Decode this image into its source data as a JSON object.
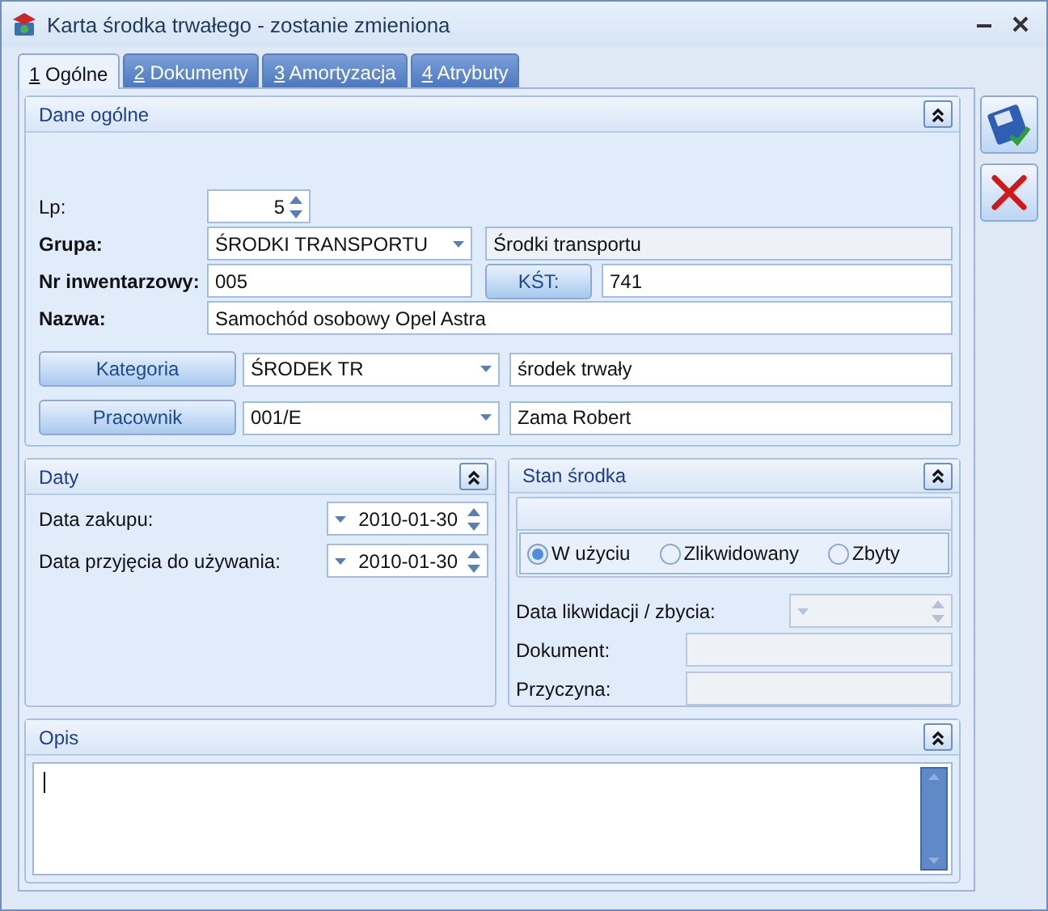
{
  "window": {
    "title": "Karta środka trwałego - zostanie zmieniona"
  },
  "tabs": [
    {
      "key": "1",
      "label": "Ogólne",
      "selected": true
    },
    {
      "key": "2",
      "label": "Dokumenty",
      "selected": false
    },
    {
      "key": "3",
      "label": "Amortyzacja",
      "selected": false
    },
    {
      "key": "4",
      "label": "Atrybuty",
      "selected": false
    }
  ],
  "general": {
    "title": "Dane ogólne",
    "expanded": true,
    "lp": {
      "label": "Lp:",
      "required": false,
      "value": "5"
    },
    "grupa": {
      "label": "Grupa:",
      "required": true,
      "value": "ŚRODKI TRANSPORTU",
      "description": "Środki transportu"
    },
    "nr": {
      "label": "Nr inwentarzowy:",
      "required": true,
      "value": "005",
      "button": "KŚT:",
      "kst": "741"
    },
    "nazwa": {
      "label": "Nazwa:",
      "required": true,
      "value": "Samochód osobowy Opel Astra"
    },
    "pickers": [
      {
        "button": "Kategoria",
        "value": "ŚRODEK TR",
        "description": "środek trwały"
      },
      {
        "button": "Pracownik",
        "value": "001/E",
        "description": "Zama Robert"
      }
    ]
  },
  "dates": {
    "title": "Daty",
    "expanded": true,
    "rows": [
      {
        "label": "Data zakupu:",
        "value": "2010-01-30"
      },
      {
        "label": "Data przyjęcia do używania:",
        "value": "2010-01-30"
      }
    ]
  },
  "status": {
    "title": "Stan środka",
    "expanded": true,
    "options": [
      {
        "label": "W użyciu",
        "selected": true
      },
      {
        "label": "Zlikwidowany",
        "selected": false
      },
      {
        "label": "Zbyty",
        "selected": false
      }
    ],
    "fields": [
      {
        "kind": "date",
        "label": "Data likwidacji / zbycia:",
        "disabled": true
      },
      {
        "kind": "text",
        "label": "Dokument:",
        "disabled": true
      },
      {
        "kind": "text",
        "label": "Przyczyna:",
        "disabled": true
      }
    ]
  },
  "description": {
    "title": "Opis",
    "expanded": true
  }
}
